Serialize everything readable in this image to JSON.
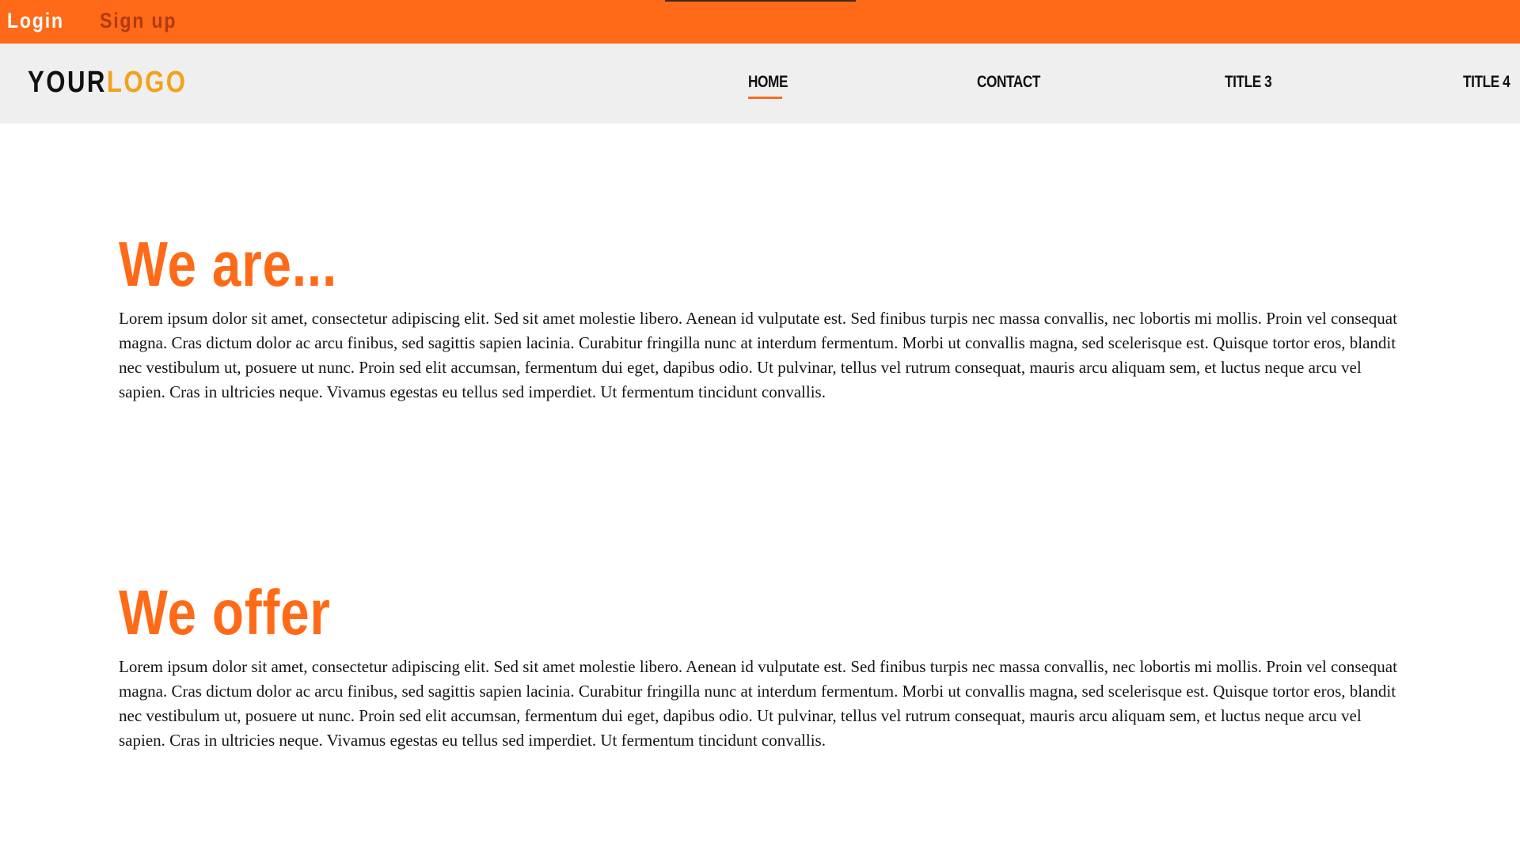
{
  "topbar": {
    "login_label": "Login",
    "signup_label": "Sign up"
  },
  "header": {
    "logo_part1": "YOUR",
    "logo_part2": "LOGO",
    "nav": [
      {
        "label": "HOME",
        "active": true
      },
      {
        "label": "CONTACT"
      },
      {
        "label": "TITLE 3"
      },
      {
        "label": "TITLE 4"
      }
    ]
  },
  "sections": [
    {
      "title": "We are...",
      "body": "Lorem ipsum dolor sit amet, consectetur adipiscing elit. Sed sit amet molestie libero. Aenean id vulputate est. Sed finibus turpis nec massa convallis, nec lobortis mi mollis. Proin vel consequat magna. Cras dictum dolor ac arcu finibus, sed sagittis sapien lacinia. Curabitur fringilla nunc at interdum fermentum. Morbi ut convallis magna, sed scelerisque est. Quisque tortor eros, blandit nec vestibulum ut, posuere ut nunc. Proin sed elit accumsan, fermentum dui eget, dapibus odio. Ut pulvinar, tellus vel rutrum consequat, mauris arcu aliquam sem, et luctus neque arcu vel sapien. Cras in ultricies neque. Vivamus egestas eu tellus sed imperdiet. Ut fermentum tincidunt convallis."
    },
    {
      "title": "We offer",
      "body": "Lorem ipsum dolor sit amet, consectetur adipiscing elit. Sed sit amet molestie libero. Aenean id vulputate est. Sed finibus turpis nec massa convallis, nec lobortis mi mollis. Proin vel consequat magna. Cras dictum dolor ac arcu finibus, sed sagittis sapien lacinia. Curabitur fringilla nunc at interdum fermentum. Morbi ut convallis magna, sed scelerisque est. Quisque tortor eros, blandit nec vestibulum ut, posuere ut nunc. Proin sed elit accumsan, fermentum dui eget, dapibus odio. Ut pulvinar, tellus vel rutrum consequat, mauris arcu aliquam sem, et luctus neque arcu vel sapien. Cras in ultricies neque. Vivamus egestas eu tellus sed imperdiet. Ut fermentum tincidunt convallis."
    }
  ],
  "colors": {
    "accent": "#ff6a18",
    "logo_highlight": "#f3a21b",
    "nav_background": "#f0eff0",
    "signup_text": "#b03a12"
  }
}
